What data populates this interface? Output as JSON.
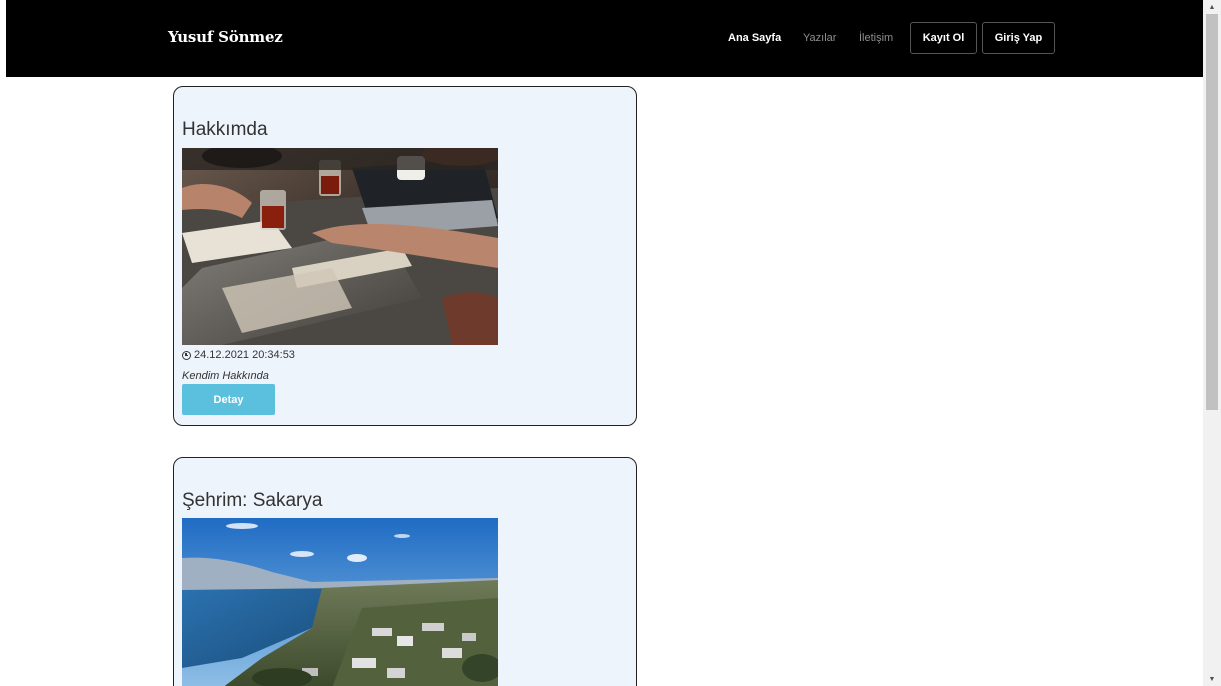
{
  "navbar": {
    "brand": "Yusuf Sönmez",
    "links": [
      {
        "label": "Ana Sayfa",
        "active": true
      },
      {
        "label": "Yazılar",
        "active": false
      },
      {
        "label": "İletişim",
        "active": false
      }
    ],
    "buttons": [
      {
        "label": "Kayıt Ol"
      },
      {
        "label": "Giriş Yap"
      }
    ]
  },
  "posts": [
    {
      "title": "Hakkımda",
      "date": "24.12.2021 20:34:53",
      "summary": "Kendim Hakkında",
      "button_label": "Detay",
      "image_icon": "photo-meeting-table"
    },
    {
      "title": "Şehrim: Sakarya",
      "image_icon": "photo-sakarya-landscape"
    }
  ],
  "colors": {
    "navbar_bg": "#000000",
    "card_bg": "#eef4fc",
    "detail_button": "#5bc0de"
  }
}
